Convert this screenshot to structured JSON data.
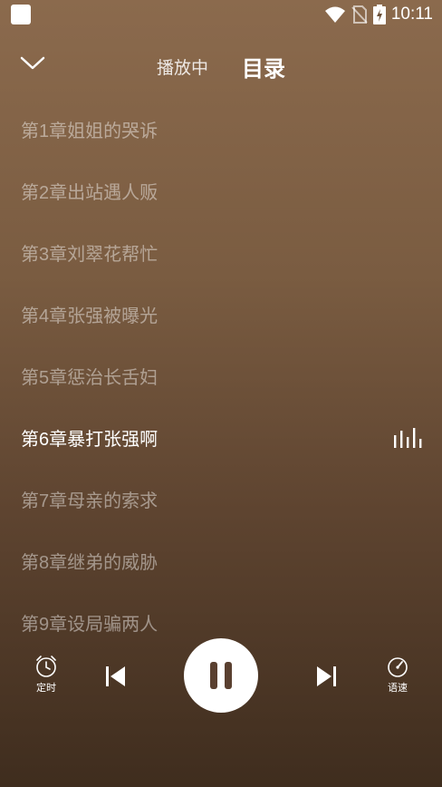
{
  "status_bar": {
    "time": "10:11"
  },
  "header": {
    "tab_playing": "播放中",
    "tab_catalog": "目录"
  },
  "chapters": [
    {
      "title": "第1章姐姐的哭诉"
    },
    {
      "title": "第2章出站遇人贩"
    },
    {
      "title": "第3章刘翠花帮忙"
    },
    {
      "title": "第4章张强被曝光"
    },
    {
      "title": "第5章惩治长舌妇"
    },
    {
      "title": "第6章暴打张强啊",
      "active": true
    },
    {
      "title": "第7章母亲的索求"
    },
    {
      "title": "第8章继弟的威胁"
    },
    {
      "title": "第9章设局骗两人"
    }
  ],
  "controls": {
    "timer_label": "定时",
    "speed_label": "语速"
  },
  "colors": {
    "accent": "#ffffff",
    "pause_icon": "#5a4030",
    "inactive_text": "rgba(255,255,255,0.45)"
  }
}
